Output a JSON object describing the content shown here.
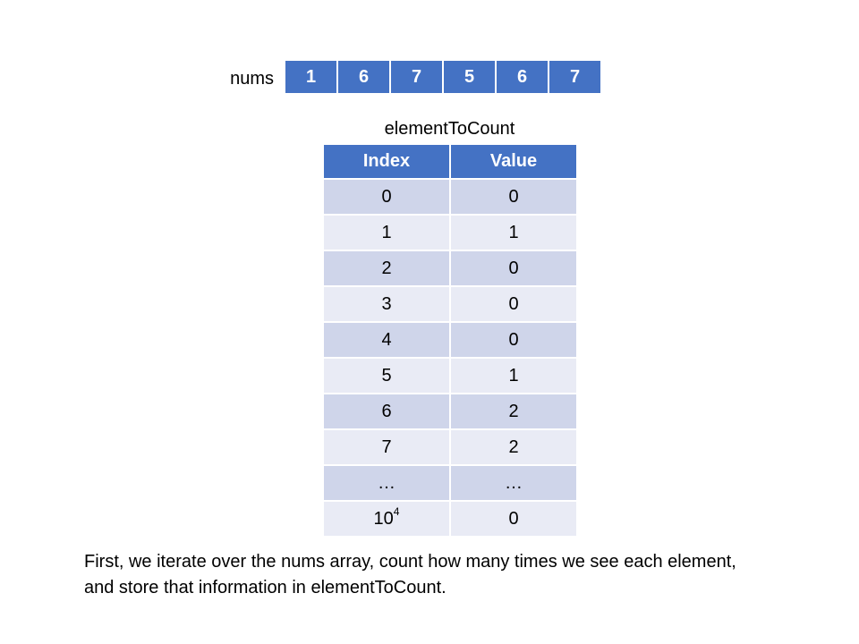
{
  "nums": {
    "label": "nums",
    "values": [
      "1",
      "6",
      "7",
      "5",
      "6",
      "7"
    ]
  },
  "table": {
    "caption": "elementToCount",
    "headers": {
      "index": "Index",
      "value": "Value"
    },
    "rows": [
      {
        "index": "0",
        "value": "0"
      },
      {
        "index": "1",
        "value": "1"
      },
      {
        "index": "2",
        "value": "0"
      },
      {
        "index": "3",
        "value": "0"
      },
      {
        "index": "4",
        "value": "0"
      },
      {
        "index": "5",
        "value": "1"
      },
      {
        "index": "6",
        "value": "2"
      },
      {
        "index": "7",
        "value": "2"
      },
      {
        "index": "…",
        "value": "…"
      },
      {
        "index_base": "10",
        "index_exp": "4",
        "value": "0"
      }
    ]
  },
  "explanation": {
    "line1": "First, we iterate over the nums array, count how many times we see each element,",
    "line2": "and store that information in elementToCount."
  },
  "colors": {
    "header_blue": "#4472c4",
    "row_dark": "#cfd5ea",
    "row_light": "#e9ebf5"
  }
}
